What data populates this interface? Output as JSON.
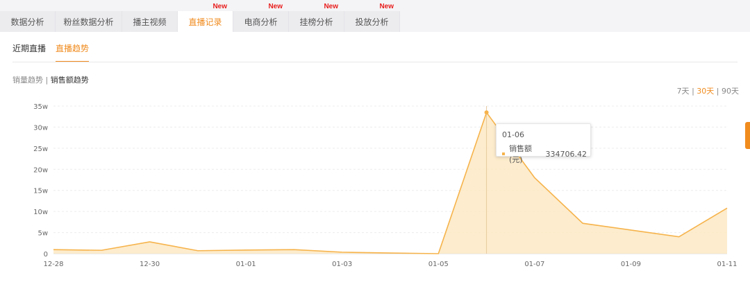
{
  "tabs": [
    {
      "label": "数据分析",
      "is_new": false
    },
    {
      "label": "粉丝数据分析",
      "is_new": false
    },
    {
      "label": "播主视频",
      "is_new": false
    },
    {
      "label": "直播记录",
      "is_new": true
    },
    {
      "label": "电商分析",
      "is_new": true
    },
    {
      "label": "挂榜分析",
      "is_new": true
    },
    {
      "label": "投放分析",
      "is_new": true
    }
  ],
  "active_tab": "直播记录",
  "new_badge": "New",
  "subtabs": [
    "近期直播",
    "直播趋势"
  ],
  "active_subtab": "直播趋势",
  "metric_toggle": {
    "option1": "销量趋势",
    "separator": "|",
    "option2": "销售额趋势",
    "selected": "销售额趋势"
  },
  "range_toggle": {
    "r7": "7天",
    "r30": "30天",
    "r90": "90天",
    "sep": "|",
    "selected": "30天"
  },
  "tooltip": {
    "date": "01-06",
    "series": "销售额(元)",
    "value": "334706.42"
  },
  "colors": {
    "accent": "#f08b1e",
    "line": "#f6b34b",
    "fill": "#fde9c4",
    "new_badge": "#e81c1c"
  },
  "chart_data": {
    "type": "area",
    "x": [
      "12-28",
      "12-29",
      "12-30",
      "12-31",
      "01-01",
      "01-02",
      "01-03",
      "01-04",
      "01-05",
      "01-06",
      "01-07",
      "01-08",
      "01-09",
      "01-10",
      "01-11"
    ],
    "x_tick_labels": [
      "12-28",
      "12-30",
      "01-01",
      "01-03",
      "01-05",
      "01-07",
      "01-09",
      "01-11"
    ],
    "series": [
      {
        "name": "销售额(元)",
        "values": [
          9500,
          8000,
          28000,
          7000,
          8500,
          9500,
          3500,
          1500,
          0,
          334706.42,
          180000,
          72000,
          56000,
          40000,
          108000
        ]
      }
    ],
    "y_ticks": [
      0,
      50000,
      100000,
      150000,
      200000,
      250000,
      300000,
      350000
    ],
    "y_tick_labels": [
      "0",
      "5w",
      "10w",
      "15w",
      "20w",
      "25w",
      "30w",
      "35w"
    ],
    "ylim": [
      0,
      350000
    ],
    "grid": true,
    "highlight_index": 9
  }
}
